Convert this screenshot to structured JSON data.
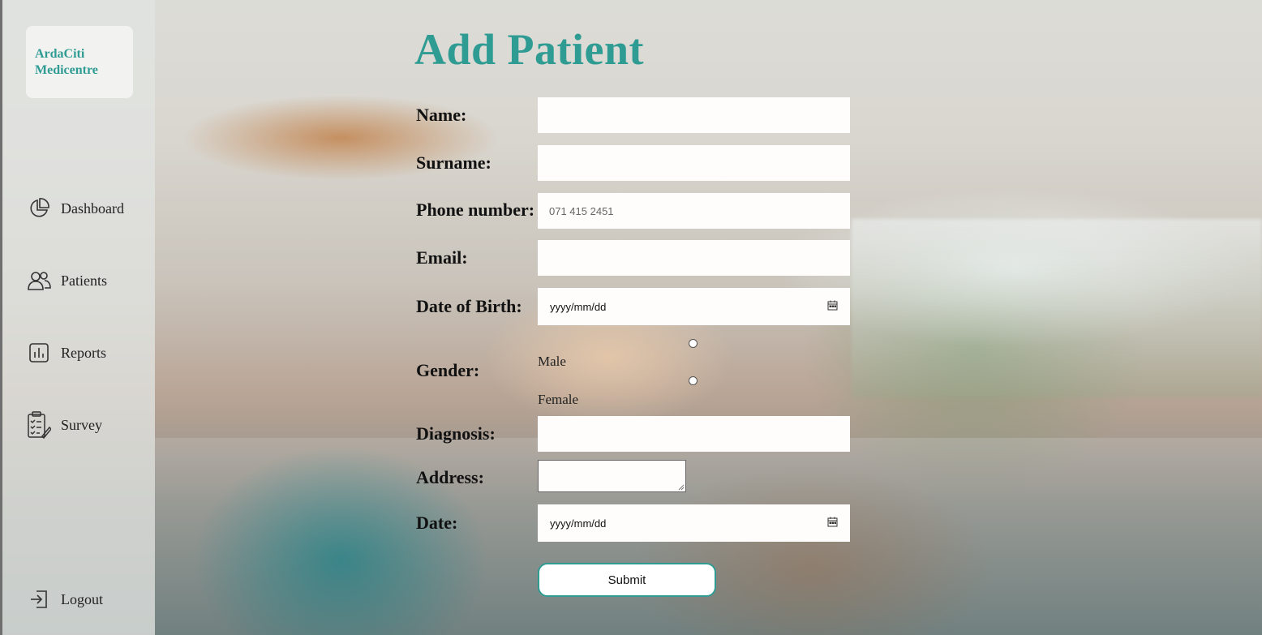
{
  "brand": {
    "line1": "ArdaCiti",
    "line2": "Medicentre",
    "color": "#2f9c94"
  },
  "nav": {
    "items": [
      {
        "label": "Dashboard",
        "icon": "pie-chart-icon"
      },
      {
        "label": "Patients",
        "icon": "users-icon"
      },
      {
        "label": "Reports",
        "icon": "bar-chart-icon"
      },
      {
        "label": "Survey",
        "icon": "clipboard-survey-icon"
      }
    ],
    "logout": {
      "label": "Logout",
      "icon": "logout-icon"
    }
  },
  "page": {
    "title": "Add Patient"
  },
  "form": {
    "name_label": "Name:",
    "surname_label": "Surname:",
    "phone_label": "Phone number:",
    "phone_placeholder": "071 415 2451",
    "email_label": "Email:",
    "dob_label": "Date of Birth:",
    "dob_placeholder": "yyyy/mm/dd",
    "gender_label": "Gender:",
    "gender_options": [
      "Male",
      "Female"
    ],
    "diagnosis_label": "Diagnosis:",
    "address_label": "Address:",
    "date_label": "Date:",
    "date_placeholder": "yyyy/mm/dd",
    "submit_label": "Submit"
  }
}
